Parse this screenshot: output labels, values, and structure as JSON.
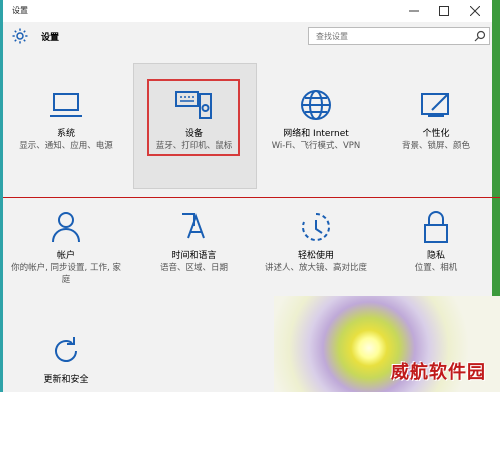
{
  "window": {
    "title": "设置"
  },
  "header": {
    "app_title": "设置",
    "search_placeholder": "查找设置"
  },
  "tiles": [
    {
      "name": "系统",
      "desc": "显示、通知、应用、电源",
      "icon": "laptop-icon"
    },
    {
      "name": "设备",
      "desc": "蓝牙、打印机、鼠标",
      "icon": "keyboard-speaker-icon"
    },
    {
      "name": "网络和 Internet",
      "desc": "Wi-Fi、飞行模式、VPN",
      "icon": "globe-icon"
    },
    {
      "name": "个性化",
      "desc": "背景、锁屏、颜色",
      "icon": "paintbrush-icon"
    },
    {
      "name": "帐户",
      "desc": "你的帐户, 同步设置, 工作, 家庭",
      "icon": "person-icon"
    },
    {
      "name": "时间和语言",
      "desc": "语音、区域、日期",
      "icon": "time-language-icon"
    },
    {
      "name": "轻松使用",
      "desc": "讲述人、放大镜、高对比度",
      "icon": "ease-of-access-icon"
    },
    {
      "name": "隐私",
      "desc": "位置、相机",
      "icon": "lock-icon"
    },
    {
      "name": "更新和安全",
      "desc": "",
      "icon": "refresh-icon"
    }
  ],
  "watermark": {
    "text": "威航软件园"
  },
  "colors": {
    "accent": "#1a5fb4",
    "highlight_border": "#d63b3b"
  }
}
